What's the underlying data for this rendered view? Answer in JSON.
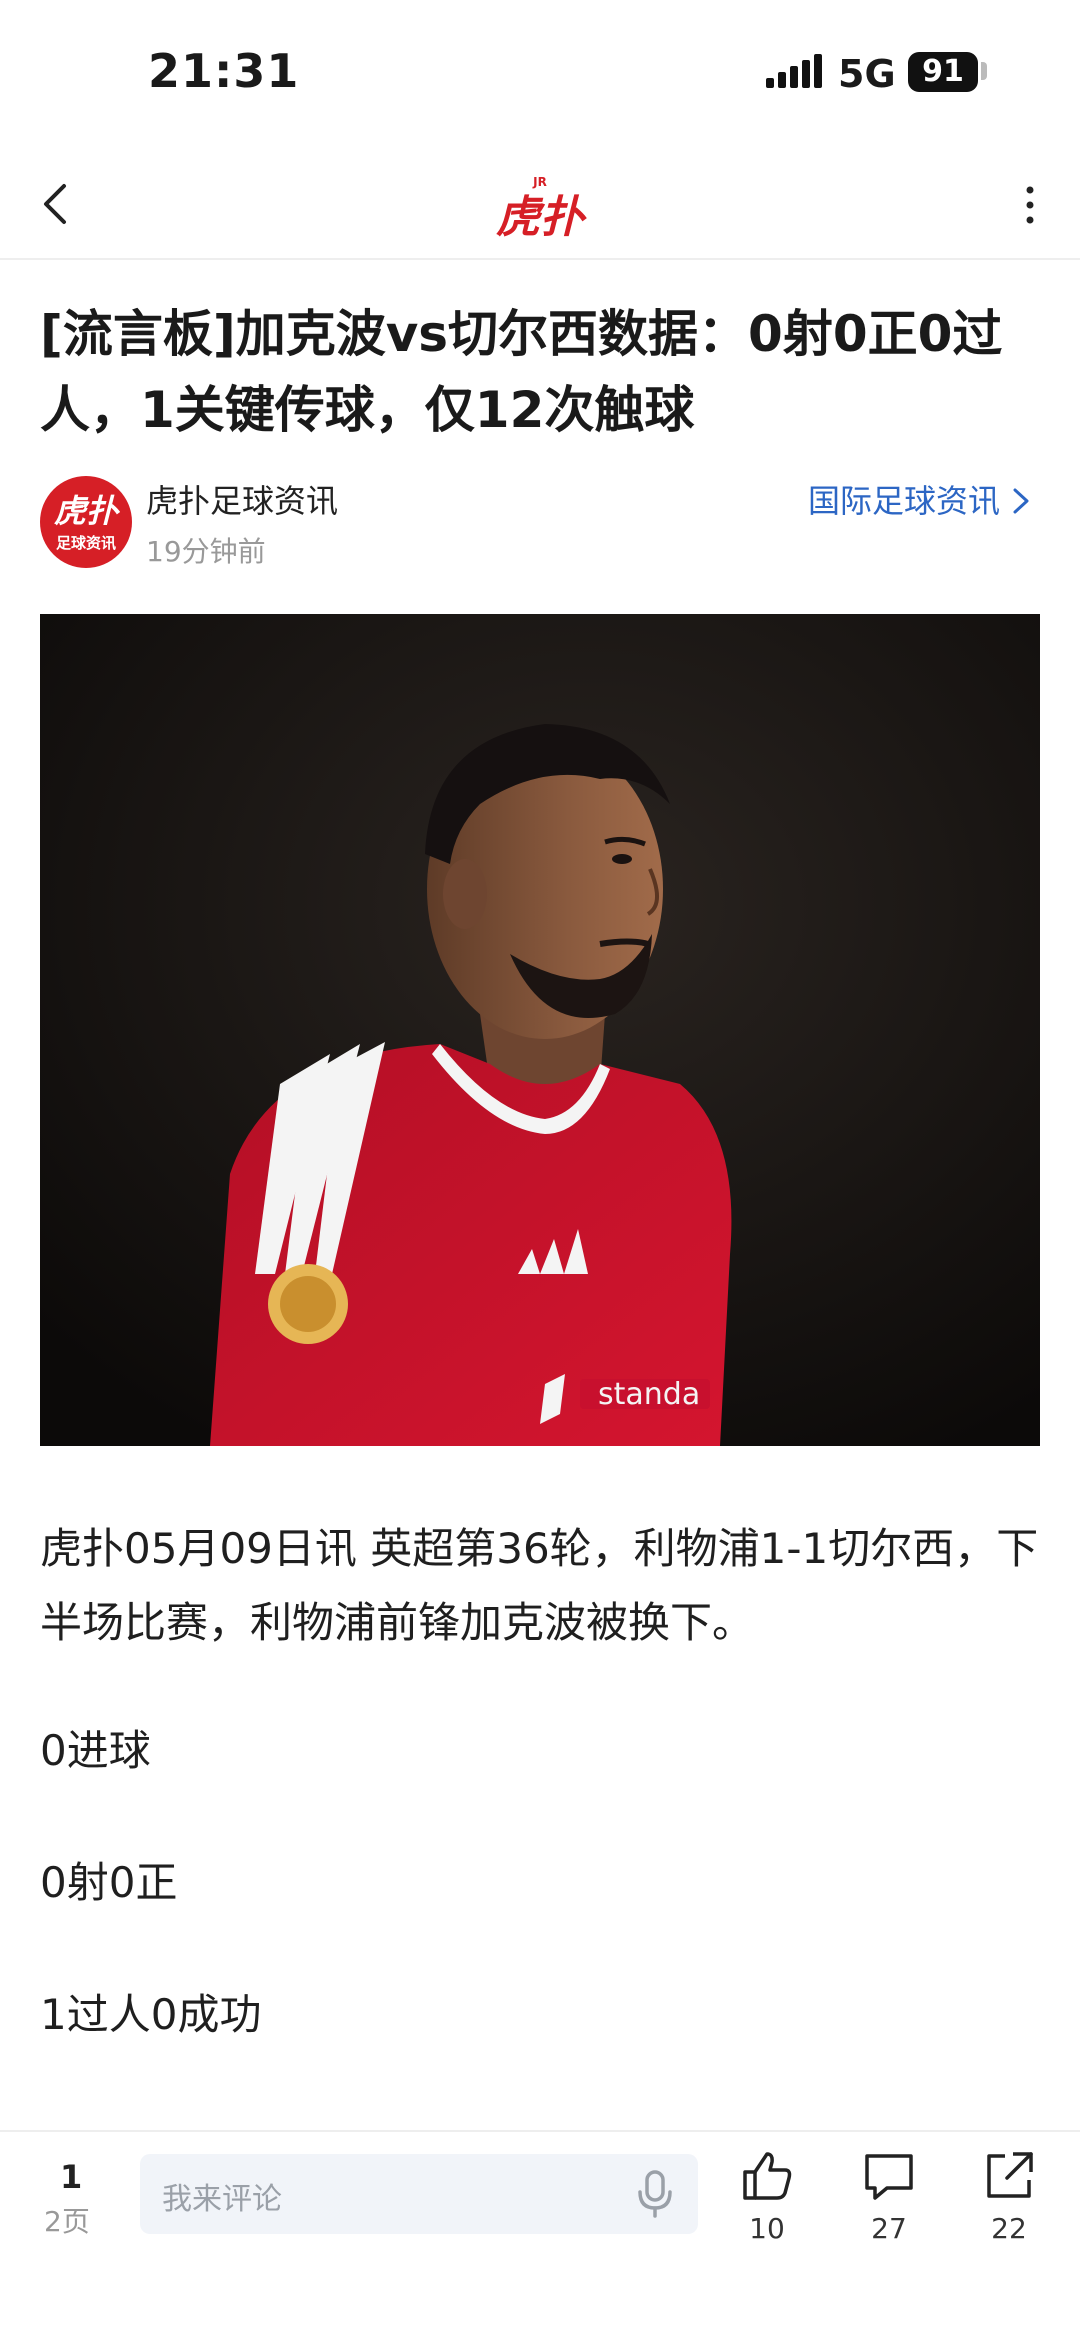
{
  "status_bar": {
    "time": "21:31",
    "network": "5G",
    "battery": "91"
  },
  "nav": {
    "logo_text": "虎扑",
    "logo_superscript": "JR"
  },
  "article": {
    "title": "[流言板]加克波vs切尔西数据：0射0正0过人，1关键传球，仅12次触球",
    "author": {
      "name": "虎扑足球资讯",
      "time": "19分钟前",
      "avatar_text_main": "虎扑",
      "avatar_text_sub": "足球资讯"
    },
    "channel_link": "国际足球资讯",
    "paragraphs": [
      "虎扑05月09日讯 英超第36轮，利物浦1-1切尔西，下半场比赛，利物浦前锋加克波被换下。",
      "0进球",
      "0射0正",
      "1过人0成功"
    ]
  },
  "bottom_bar": {
    "page_current": "1",
    "page_total": "2页",
    "comment_placeholder": "我来评论",
    "actions": [
      {
        "icon": "thumbs-up-icon",
        "count": "10"
      },
      {
        "icon": "comment-icon",
        "count": "27"
      },
      {
        "icon": "share-icon",
        "count": "22"
      }
    ]
  },
  "colors": {
    "brand_red": "#d61f26",
    "link_blue": "#2c66c4",
    "jersey_red": "#c8102e"
  }
}
